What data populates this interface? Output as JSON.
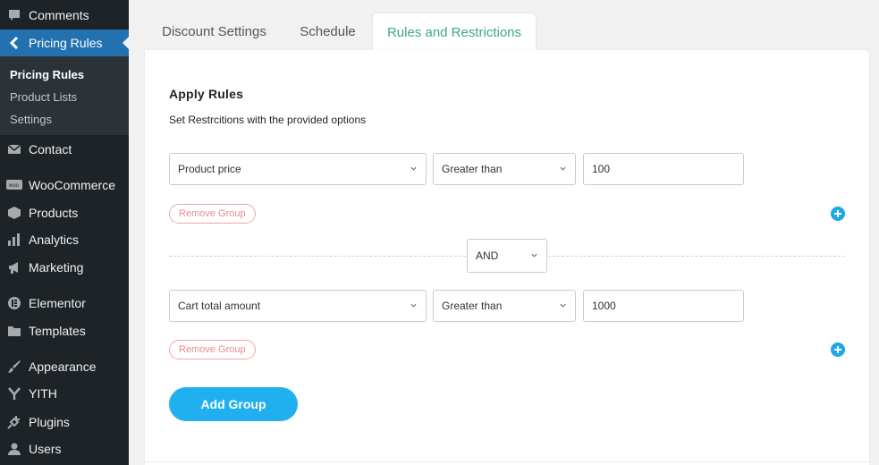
{
  "sidebar": {
    "items": [
      {
        "label": "Comments",
        "icon": "comment-icon"
      },
      {
        "label": "Pricing Rules",
        "icon": "back-arrow-icon",
        "active": true
      },
      {
        "label": "Contact",
        "icon": "envelope-icon"
      },
      {
        "label": "WooCommerce",
        "icon": "woo-icon"
      },
      {
        "label": "Products",
        "icon": "box-icon"
      },
      {
        "label": "Analytics",
        "icon": "bar-chart-icon"
      },
      {
        "label": "Marketing",
        "icon": "megaphone-icon"
      },
      {
        "label": "Elementor",
        "icon": "elementor-icon"
      },
      {
        "label": "Templates",
        "icon": "folder-icon"
      },
      {
        "label": "Appearance",
        "icon": "brush-icon"
      },
      {
        "label": "YITH",
        "icon": "yith-icon"
      },
      {
        "label": "Plugins",
        "icon": "plug-icon"
      },
      {
        "label": "Users",
        "icon": "user-icon"
      }
    ],
    "submenu": [
      "Pricing Rules",
      "Product Lists",
      "Settings"
    ]
  },
  "tabs": [
    "Discount Settings",
    "Schedule",
    "Rules and Restrictions"
  ],
  "active_tab": "Rules and Restrictions",
  "main": {
    "heading": "Apply Rules",
    "subtext": "Set Restrcitions with the provided options",
    "groups": [
      {
        "field": "Product price",
        "operator": "Greater than",
        "value": "100",
        "remove_label": "Remove Group"
      },
      {
        "field": "Cart total amount",
        "operator": "Greater than",
        "value": "1000",
        "remove_label": "Remove Group"
      }
    ],
    "connector": "AND",
    "add_group_label": "Add Group"
  },
  "colors": {
    "sidebar_bg": "#1d2327",
    "active_menu": "#2271b1",
    "active_tab_text": "#3aa88d",
    "add_button": "#20b0ef",
    "remove_button": "#ec8a8a"
  }
}
